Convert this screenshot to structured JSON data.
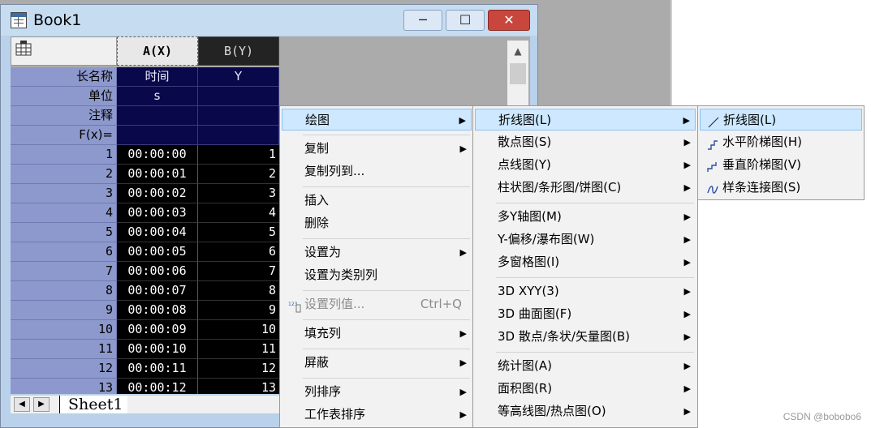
{
  "window": {
    "title": "Book1",
    "min_label": "─",
    "max_label": "☐",
    "close_label": "✕"
  },
  "columns": {
    "a_header": "A(X)",
    "b_header": "B(Y)"
  },
  "meta_rows": [
    {
      "label": "长名称",
      "a": "时间",
      "b": "Y"
    },
    {
      "label": "单位",
      "a": "s",
      "b": ""
    },
    {
      "label": "注释",
      "a": "",
      "b": ""
    },
    {
      "label": "F(x)=",
      "a": "",
      "b": ""
    }
  ],
  "rows": [
    {
      "n": "1",
      "a": "00:00:00",
      "b": "1"
    },
    {
      "n": "2",
      "a": "00:00:01",
      "b": "2"
    },
    {
      "n": "3",
      "a": "00:00:02",
      "b": "3"
    },
    {
      "n": "4",
      "a": "00:00:03",
      "b": "4"
    },
    {
      "n": "5",
      "a": "00:00:04",
      "b": "5"
    },
    {
      "n": "6",
      "a": "00:00:05",
      "b": "6"
    },
    {
      "n": "7",
      "a": "00:00:06",
      "b": "7"
    },
    {
      "n": "8",
      "a": "00:00:07",
      "b": "8"
    },
    {
      "n": "9",
      "a": "00:00:08",
      "b": "9"
    },
    {
      "n": "10",
      "a": "00:00:09",
      "b": "10"
    },
    {
      "n": "11",
      "a": "00:00:10",
      "b": "11"
    },
    {
      "n": "12",
      "a": "00:00:11",
      "b": "12"
    },
    {
      "n": "13",
      "a": "00:00:12",
      "b": "13"
    }
  ],
  "sheet": {
    "tab_label": "Sheet1",
    "nav_left": "◀",
    "nav_right": "▶"
  },
  "scroll_up": "▲",
  "context_menu": {
    "items": [
      {
        "label": "绘图",
        "submenu": true,
        "highlighted": true
      },
      {
        "label": "复制",
        "submenu": true
      },
      {
        "label": "复制列到...",
        "submenu": false
      },
      {
        "label": "插入",
        "submenu": false
      },
      {
        "label": "删除",
        "submenu": false
      },
      {
        "label": "设置为",
        "submenu": true
      },
      {
        "label": "设置为类别列",
        "submenu": false
      },
      {
        "label": "设置列值...",
        "shortcut": "Ctrl+Q",
        "disabled": true,
        "icon": "set-column-values-icon"
      },
      {
        "label": "填充列",
        "submenu": true
      },
      {
        "label": "屏蔽",
        "submenu": true
      },
      {
        "label": "列排序",
        "submenu": true
      },
      {
        "label": "工作表排序",
        "submenu": true
      }
    ]
  },
  "plot_submenu": {
    "items": [
      {
        "label": "折线图(L)",
        "highlighted": true
      },
      {
        "label": "散点图(S)"
      },
      {
        "label": "点线图(Y)"
      },
      {
        "label": "柱状图/条形图/饼图(C)"
      },
      {
        "label": "多Y轴图(M)"
      },
      {
        "label": "Y-偏移/瀑布图(W)"
      },
      {
        "label": "多窗格图(I)"
      },
      {
        "label": "3D XYY(3)"
      },
      {
        "label": "3D 曲面图(F)"
      },
      {
        "label": "3D 散点/条状/矢量图(B)"
      },
      {
        "label": "统计图(A)"
      },
      {
        "label": "面积图(R)"
      },
      {
        "label": "等高线图/热点图(O)"
      }
    ]
  },
  "line_submenu": {
    "items": [
      {
        "label": "折线图(L)",
        "icon": "line-plot-icon",
        "highlighted": true
      },
      {
        "label": "水平阶梯图(H)",
        "icon": "horizontal-step-icon"
      },
      {
        "label": "垂直阶梯图(V)",
        "icon": "vertical-step-icon"
      },
      {
        "label": "样条连接图(S)",
        "icon": "spline-icon"
      }
    ]
  },
  "submenu_arrow": "▶",
  "watermark": "CSDN @bobobo6"
}
